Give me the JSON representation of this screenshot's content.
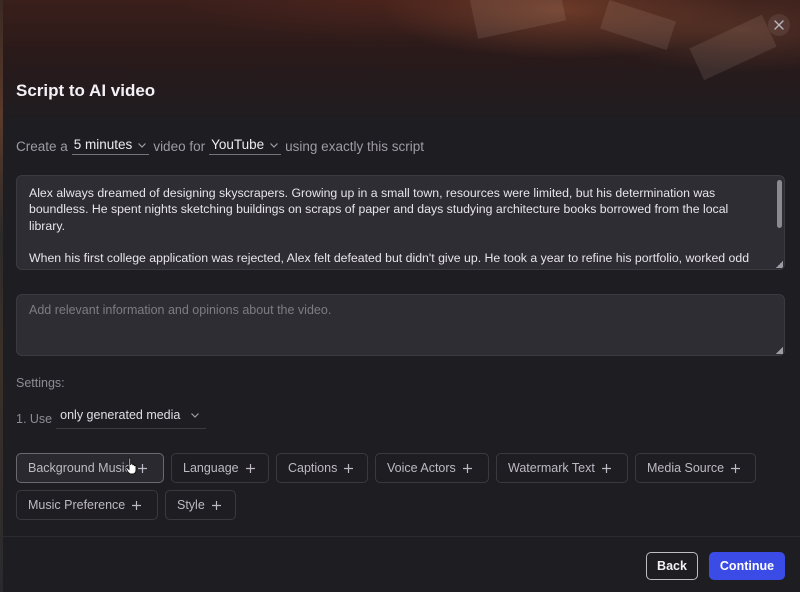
{
  "dialog": {
    "title": "Script to AI video"
  },
  "create_line": {
    "prefix": "Create a",
    "duration_value": "5 minutes",
    "middle": "video for",
    "platform_value": "YouTube",
    "suffix": "using exactly this script"
  },
  "script": {
    "paragraph_1": "Alex always dreamed of designing skyscrapers. Growing up in a small town, resources were limited, but his determination was boundless. He spent nights sketching buildings on scraps of paper and days studying architecture books borrowed from the local library.",
    "paragraph_2": "When his first college application was rejected, Alex felt defeated but didn't give up. He took a year to refine his portfolio, worked odd jobs to save money, and applied again. This time, he got in."
  },
  "notes": {
    "placeholder": "Add relevant information and opinions about the video."
  },
  "settings": {
    "label": "Settings:",
    "use_prefix": "1. Use",
    "use_value": "only generated media"
  },
  "options": [
    {
      "label": "Background Music"
    },
    {
      "label": "Language"
    },
    {
      "label": "Captions"
    },
    {
      "label": "Voice Actors"
    },
    {
      "label": "Watermark Text"
    },
    {
      "label": "Media Source"
    },
    {
      "label": "Music Preference"
    },
    {
      "label": "Style"
    }
  ],
  "footer": {
    "back_label": "Back",
    "continue_label": "Continue"
  },
  "colors": {
    "primary": "#3b4ce6",
    "panel_bg": "#1e1d22",
    "input_bg": "#2e2d33"
  },
  "icons": {
    "close": "close-icon",
    "dropdown": "chevron-down-icon",
    "add": "plus-icon",
    "cursor": "pointer-hand-cursor"
  }
}
